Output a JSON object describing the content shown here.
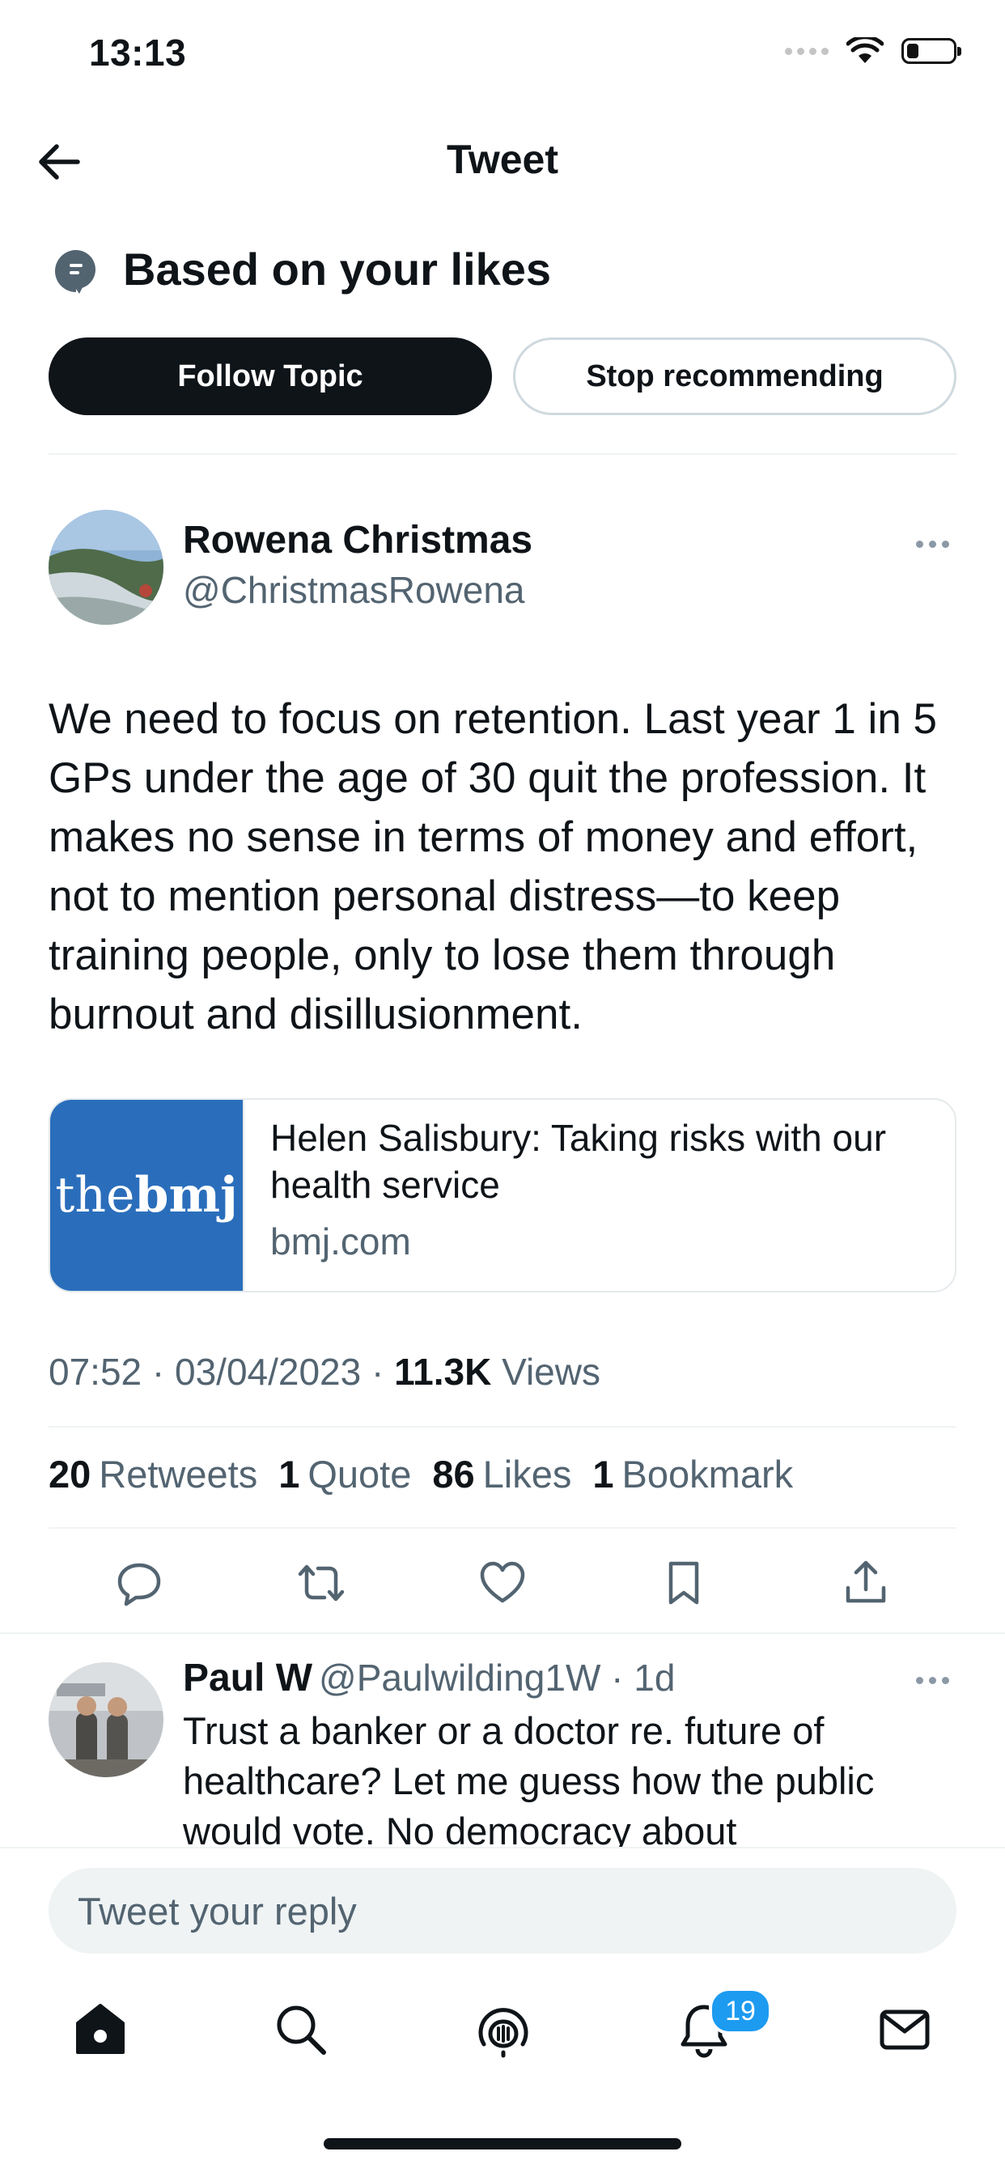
{
  "status_bar": {
    "time": "13:13"
  },
  "header": {
    "title": "Tweet"
  },
  "topic": {
    "label": "Based on your likes",
    "follow_button": "Follow Topic",
    "stop_button": "Stop recommending"
  },
  "tweet": {
    "author_name": "Rowena Christmas",
    "author_handle": "@ChristmasRowena",
    "text": "We need to focus on retention. Last year 1 in 5 GPs under the age of 30 quit the profession. It makes no sense in terms of money and effort, not to mention personal distress—to keep training people, only to lose them through burnout and disillusionment.",
    "card": {
      "logo_prefix": "the",
      "logo_bold": "bmj",
      "title": "Helen Salisbury: Taking risks with our health service",
      "domain": "bmj.com"
    },
    "timestamp": "07:52 · 03/04/2023 · ",
    "views_count": "11.3K",
    "views_label": " Views",
    "stats": {
      "retweets_count": "20",
      "retweets_label": "Retweets",
      "quotes_count": "1",
      "quotes_label": "Quote",
      "likes_count": "86",
      "likes_label": "Likes",
      "bookmarks_count": "1",
      "bookmarks_label": "Bookmark"
    }
  },
  "reply": {
    "name": "Paul W",
    "handle_time": "@Paulwilding1W · 1d",
    "text": "Trust a banker or a doctor re. future of healthcare? Let me guess how the public would vote. No democracy about"
  },
  "composer": {
    "placeholder": "Tweet your reply"
  },
  "tabbar": {
    "notifications_badge": "19"
  },
  "icons": [
    "back-arrow-icon",
    "topic-icon",
    "more-icon",
    "reply-icon",
    "retweet-icon",
    "like-icon",
    "bookmark-icon",
    "share-icon",
    "home-icon",
    "search-icon",
    "spaces-icon",
    "notifications-icon",
    "messages-icon"
  ],
  "colors": {
    "accent": "#1d9bf0",
    "text": "#0f1419",
    "secondary": "#536471",
    "bmj_blue": "#2a6ebb"
  }
}
